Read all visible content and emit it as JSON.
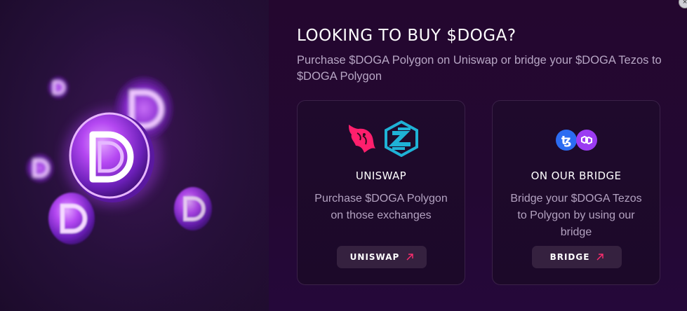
{
  "modal": {
    "title": "LOOKING TO BUY $DOGA?",
    "subtitle": "Purchase $DOGA Polygon on Uniswap or bridge your $DOGA Tezos to $DOGA Polygon",
    "close_icon": "close-icon"
  },
  "cards": [
    {
      "title": "UNISWAP",
      "description": "Purchase $DOGA Polygon on those exchanges",
      "button_label": "UNISWAP",
      "icons": [
        "uniswap-unicorn-icon",
        "zk-exchange-icon",
        "external-link-arrow-icon"
      ]
    },
    {
      "title": "ON OUR BRIDGE",
      "description": "Bridge your $DOGA Tezos to Polygon by using our bridge",
      "button_label": "BRIDGE",
      "icons": [
        "tezos-icon",
        "polygon-icon",
        "external-link-arrow-icon"
      ]
    }
  ],
  "colors": {
    "accent_pink": "#ff2d6f",
    "uniswap_pink": "#ff1f6d",
    "exchange_teal": "#1fb2d6",
    "tezos_blue": "#2c6cf2",
    "polygon_purple": "#9b3bf2",
    "background": "#200a30"
  }
}
